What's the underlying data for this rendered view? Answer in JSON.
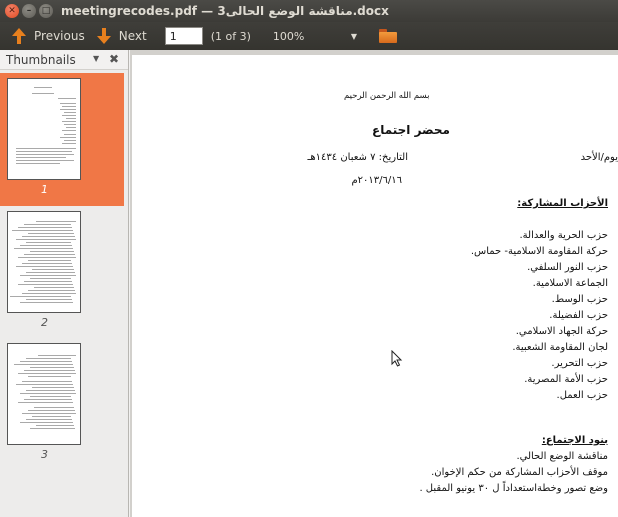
{
  "window": {
    "title": "meetingrecodes.pdf — مناقشة الوضع الحالى3.docx",
    "close_glyph": "✕",
    "min_glyph": "–",
    "max_glyph": "□"
  },
  "toolbar": {
    "previous_label": "Previous",
    "next_label": "Next",
    "page_value": "1",
    "page_count": "(1 of 3)",
    "zoom": "100%",
    "zoom_arrow": "▼",
    "accent_color": "#e8801e"
  },
  "sidebar": {
    "title": "Thumbnails",
    "dropdown_glyph": "▼",
    "close_glyph": "✖",
    "thumbnails": [
      {
        "label": "1",
        "selected": true
      },
      {
        "label": "2",
        "selected": false
      },
      {
        "label": "3",
        "selected": false
      }
    ],
    "selected_color": "#f07746"
  },
  "document": {
    "bismillah": "بسم الله الرحمن الرحيم",
    "heading": "محضر اجتماع",
    "day": "يوم/الأحد",
    "date_hijri": "التاريخ: ٧ شعبان ١٤٣٤هـ",
    "date_greg": "٢٠١٣/٦/١٦م",
    "parties_title": "الأحزاب المشاركة:",
    "parties": [
      "حزب الحرية والعدالة.",
      "حركة المقاومة الاسلامية- حماس.",
      "حزب النور السلفي.",
      "الجماعة الاسلامية.",
      "حزب الوسط.",
      "حزب الفضيلة.",
      "حركة الجهاد الاسلامي.",
      "لجان المقاومة الشعبية.",
      "حزب التحرير.",
      "حزب الأمة المصرية.",
      "حزب العمل."
    ],
    "agenda_title": "بنود الاجتماع:",
    "agenda": [
      "مناقشة الوضع الحالي.",
      "موقف الأحزاب المشاركة من حكم الإخوان.",
      "وضع تصور وخطةاستعداداً ل ٣٠ يونيو المقبل ."
    ]
  }
}
